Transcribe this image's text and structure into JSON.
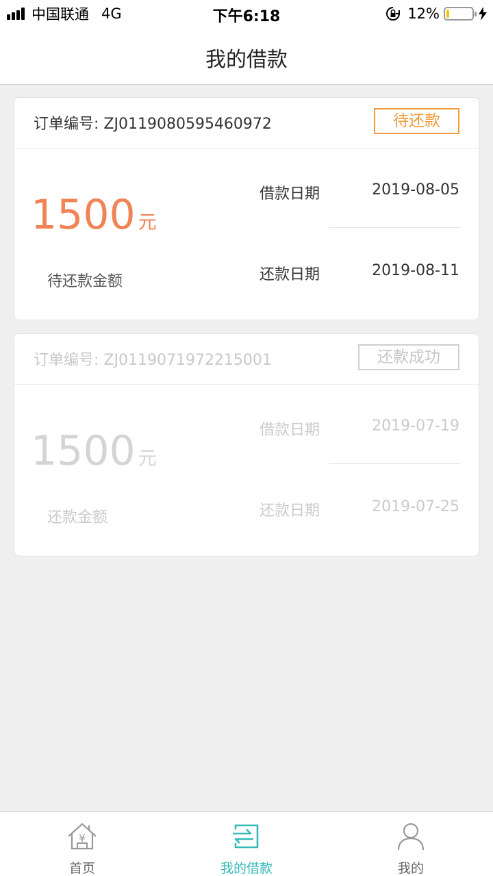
{
  "status_bar": {
    "carrier": "中国联通",
    "network": "4G",
    "time": "下午6:18",
    "battery_percent": "12%",
    "battery_level": 0.12
  },
  "header": {
    "title": "我的借款"
  },
  "colors": {
    "accent_orange": "#f09a3a",
    "amount_orange": "#f08456",
    "teal": "#34b9b7",
    "muted": "#cacaca"
  },
  "loans": [
    {
      "order_label": "订单编号: ZJ0119080595460972",
      "status": "待还款",
      "amount": "1500",
      "unit": "元",
      "amount_label": "待还款金额",
      "borrow_date_label": "借款日期",
      "borrow_date": "2019-08-05",
      "repay_date_label": "还款日期",
      "repay_date": "2019-08-11"
    },
    {
      "order_label": "订单编号: ZJ0119071972215001",
      "status": "还款成功",
      "amount": "1500",
      "unit": "元",
      "amount_label": "还款金额",
      "borrow_date_label": "借款日期",
      "borrow_date": "2019-07-19",
      "repay_date_label": "还款日期",
      "repay_date": "2019-07-25"
    }
  ],
  "tabbar": {
    "items": [
      {
        "label": "首页",
        "icon": "home-yen-icon"
      },
      {
        "label": "我的借款",
        "icon": "loan-transfer-icon",
        "active": true
      },
      {
        "label": "我的",
        "icon": "user-icon"
      }
    ]
  }
}
